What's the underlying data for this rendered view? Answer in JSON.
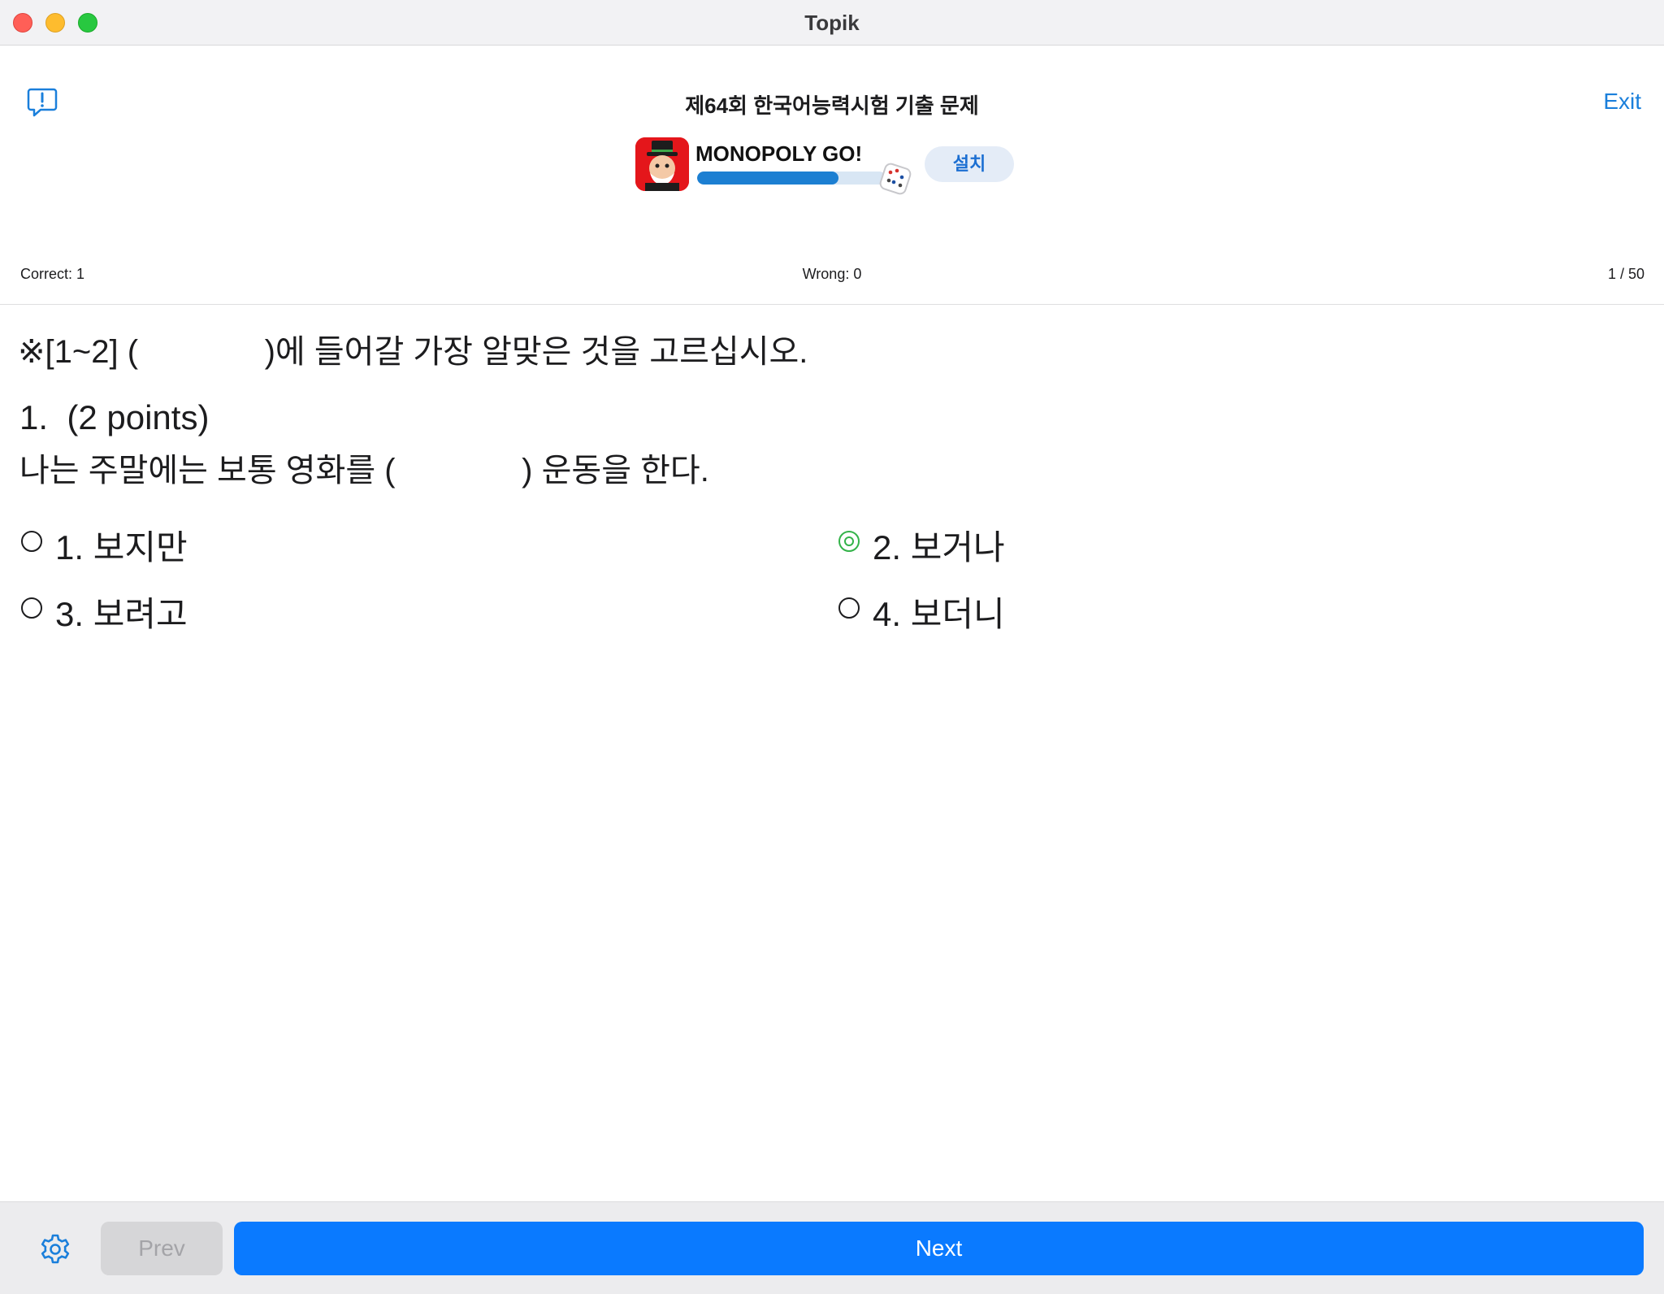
{
  "window": {
    "title": "Topik"
  },
  "header": {
    "exam_title": "제64회 한국어능력시험 기출 문제",
    "exit_label": "Exit"
  },
  "ad": {
    "app_name": "MONOPOLY GO!",
    "install_label": "설치",
    "progress_fraction": 0.75
  },
  "score": {
    "correct": "Correct: 1",
    "wrong": "Wrong: 0",
    "progress": "1 / 50"
  },
  "question": {
    "instruction": "※[1~2] (              )에 들어갈 가장 알맞은 것을 고르십시오.",
    "header": "1.  (2 points)",
    "sentence": "나는 주말에는 보통 영화를 (              ) 운동을 한다.",
    "options": [
      {
        "label": "1. 보지만",
        "selected": false
      },
      {
        "label": "2. 보거나",
        "selected": true
      },
      {
        "label": "3. 보려고",
        "selected": false
      },
      {
        "label": "4. 보더니",
        "selected": false
      }
    ]
  },
  "footer": {
    "prev_label": "Prev",
    "next_label": "Next"
  },
  "colors": {
    "accent": "#0a7aff",
    "link": "#1a7fdb",
    "selected_radio": "#34b34a",
    "ad_progress": "#1c7fd2"
  },
  "icons": {
    "feedback": "speech-bubble-exclamation-icon",
    "settings": "gear-icon",
    "ad_app": "monopoly-app-icon",
    "dice": "dice-icon"
  }
}
